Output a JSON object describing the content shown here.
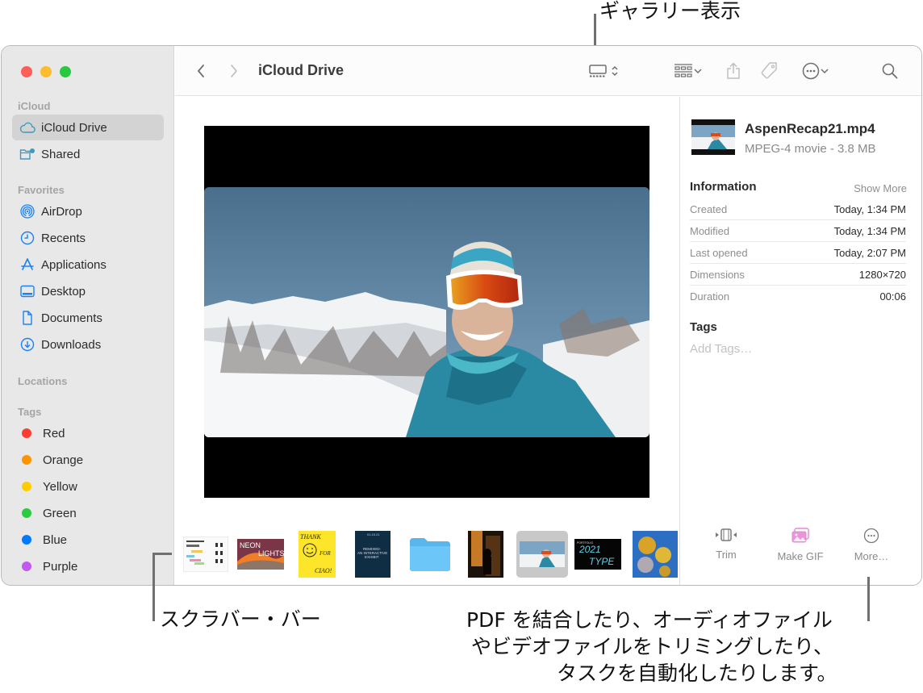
{
  "callouts": {
    "gallery_view": "ギャラリー表示",
    "scrubber_bar": "スクラバー・バー",
    "more_line1": "PDF を結合したり、オーディオファイル",
    "more_line2": "やビデオファイルをトリミングしたり、",
    "more_line3": "タスクを自動化したりします。"
  },
  "window": {
    "traffic_lights": [
      "close",
      "minimize",
      "zoom"
    ]
  },
  "sidebar": {
    "sections": {
      "icloud": "iCloud",
      "favorites": "Favorites",
      "locations": "Locations",
      "tags": "Tags"
    },
    "icloud_items": [
      {
        "label": "iCloud Drive",
        "icon": "cloud-icon",
        "selected": true
      },
      {
        "label": "Shared",
        "icon": "shared-folder-icon",
        "selected": false
      }
    ],
    "favorite_items": [
      {
        "label": "AirDrop",
        "icon": "airdrop-icon"
      },
      {
        "label": "Recents",
        "icon": "clock-icon"
      },
      {
        "label": "Applications",
        "icon": "applications-icon"
      },
      {
        "label": "Desktop",
        "icon": "desktop-icon"
      },
      {
        "label": "Documents",
        "icon": "document-icon"
      },
      {
        "label": "Downloads",
        "icon": "download-icon"
      }
    ],
    "tag_items": [
      {
        "label": "Red",
        "color": "#fe3b30"
      },
      {
        "label": "Orange",
        "color": "#fe9500"
      },
      {
        "label": "Yellow",
        "color": "#fecc00"
      },
      {
        "label": "Green",
        "color": "#28cd41"
      },
      {
        "label": "Blue",
        "color": "#007aff"
      },
      {
        "label": "Purple",
        "color": "#bf5af2"
      }
    ]
  },
  "toolbar": {
    "title": "iCloud Drive",
    "buttons": [
      "back",
      "forward",
      "gallery-view",
      "group",
      "share",
      "tag",
      "more-actions",
      "search"
    ]
  },
  "gallery": {
    "scrubber_thumbnails": [
      {
        "name": "pdf-chart-document"
      },
      {
        "name": "neon-lights-poster",
        "text": "NEON LIGHTS"
      },
      {
        "name": "thank-you-poster",
        "text": "THANK YOU FOR COMING CIAO!"
      },
      {
        "name": "remixed-exhibit-poster",
        "text": "REMIXED: AN INTERACTIVE EXHIBIT"
      },
      {
        "name": "folder"
      },
      {
        "name": "silhouette-photo"
      },
      {
        "name": "aspen-video",
        "selected": true
      },
      {
        "name": "2021-type-portfolio",
        "text": "PORTFOLIO 2021 TYPE"
      },
      {
        "name": "gold-balloons-photo"
      }
    ]
  },
  "inspector": {
    "file_name": "AspenRecap21.mp4",
    "file_kind": "MPEG-4 movie - 3.8 MB",
    "information_label": "Information",
    "show_more": "Show More",
    "rows": [
      {
        "key": "Created",
        "value": "Today, 1:34 PM"
      },
      {
        "key": "Modified",
        "value": "Today, 1:34 PM"
      },
      {
        "key": "Last opened",
        "value": "Today, 2:07 PM"
      },
      {
        "key": "Dimensions",
        "value": "1280×720"
      },
      {
        "key": "Duration",
        "value": "00:06"
      }
    ],
    "tags_label": "Tags",
    "add_tags_placeholder": "Add Tags…",
    "actions": [
      {
        "label": "Trim",
        "icon": "trim-icon"
      },
      {
        "label": "Make GIF",
        "icon": "make-gif-icon"
      },
      {
        "label": "More…",
        "icon": "more-circle-icon"
      }
    ]
  }
}
